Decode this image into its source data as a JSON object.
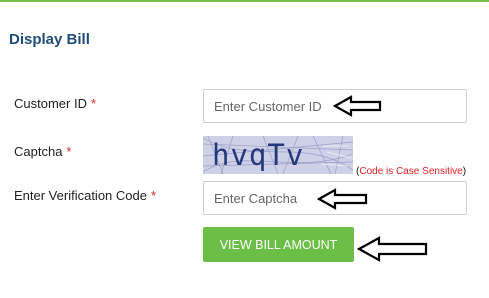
{
  "header": {
    "title": "Display Bill"
  },
  "form": {
    "customer_id": {
      "label": "Customer ID",
      "required_mark": "*",
      "placeholder": "Enter Customer ID",
      "value": ""
    },
    "captcha": {
      "label": "Captcha",
      "required_mark": "*",
      "image_text": "hvqTv",
      "note_open": "(",
      "note": "Code is Case Sensitive",
      "note_close": ")"
    },
    "verification_code": {
      "label": "Enter Verification Code",
      "required_mark": "*",
      "placeholder": "Enter Captcha",
      "value": ""
    },
    "submit_label": "VIEW BILL AMOUNT"
  },
  "annotations": {
    "arrow_icon": "left-arrow-icon"
  },
  "colors": {
    "accent": "#6cbf46",
    "title": "#1f4e79",
    "required": "#e02020"
  }
}
